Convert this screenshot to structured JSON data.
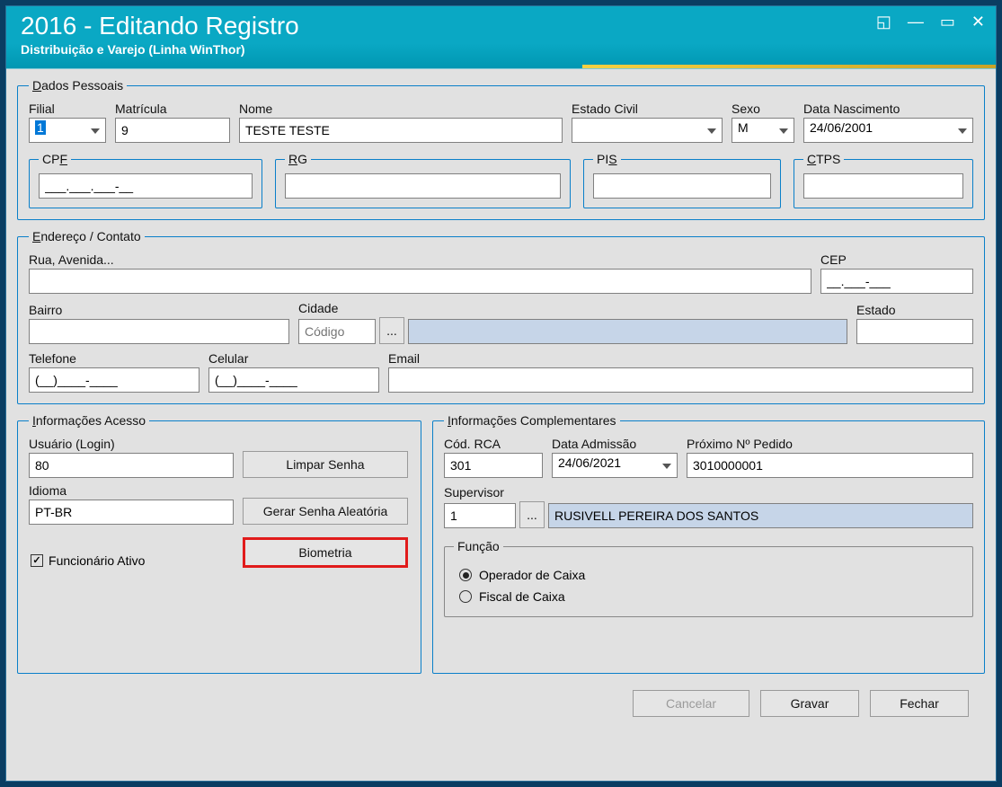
{
  "window": {
    "title": "2016 - Editando Registro",
    "subtitle": "Distribuição e Varejo (Linha WinThor)"
  },
  "dados": {
    "legend": "Dados Pessoais",
    "filial_label": "Filial",
    "filial_value": "1",
    "matricula_label": "Matrícula",
    "matricula_value": "9",
    "nome_label": "Nome",
    "nome_value": "TESTE TESTE",
    "estado_civil_label": "Estado Civil",
    "estado_civil_value": "",
    "sexo_label": "Sexo",
    "sexo_value": "M",
    "data_nasc_label": "Data Nascimento",
    "data_nasc_value": "24/06/2001",
    "cpf_label": "CPF",
    "cpf_value": "___.___.___-__",
    "rg_label": "RG",
    "rg_value": "",
    "pis_label": "PIS",
    "pis_value": "",
    "ctps_label": "CTPS",
    "ctps_value": ""
  },
  "endereco": {
    "legend": "Endereço / Contato",
    "rua_label": "Rua, Avenida...",
    "rua_value": "",
    "cep_label": "CEP",
    "cep_value": "__.___-___",
    "bairro_label": "Bairro",
    "bairro_value": "",
    "cidade_label": "Cidade",
    "cidade_placeholder": "Código",
    "cidade_lookup": "...",
    "cidade_display": "",
    "estado_label": "Estado",
    "estado_value": "",
    "tel_label": "Telefone",
    "tel_value": "(__)____-____",
    "cel_label": "Celular",
    "cel_value": "(__)____-____",
    "email_label": "Email",
    "email_value": ""
  },
  "acesso": {
    "legend": "Informações Acesso",
    "login_label": "Usuário (Login)",
    "login_value": "80",
    "idioma_label": "Idioma",
    "idioma_value": "PT-BR",
    "btn_limpar": "Limpar Senha",
    "btn_gerar": "Gerar Senha Aleatória",
    "btn_biometria": "Biometria",
    "chk_ativo_label": "Funcionário Ativo",
    "chk_ativo_checked": true
  },
  "compl": {
    "legend": "Informações Complementares",
    "cod_rca_label": "Cód. RCA",
    "cod_rca_value": "301",
    "data_adm_label": "Data Admissão",
    "data_adm_value": "24/06/2021",
    "prox_ped_label": "Próximo Nº Pedido",
    "prox_ped_value": "3010000001",
    "sup_label": "Supervisor",
    "sup_code": "1",
    "sup_lookup": "...",
    "sup_name": "RUSIVELL PEREIRA DOS SANTOS",
    "funcao_legend": "Função",
    "funcao_op": "Operador de Caixa",
    "funcao_fiscal": "Fiscal de Caixa",
    "funcao_selected": "operador"
  },
  "footer": {
    "cancelar": "Cancelar",
    "gravar": "Gravar",
    "fechar": "Fechar"
  }
}
